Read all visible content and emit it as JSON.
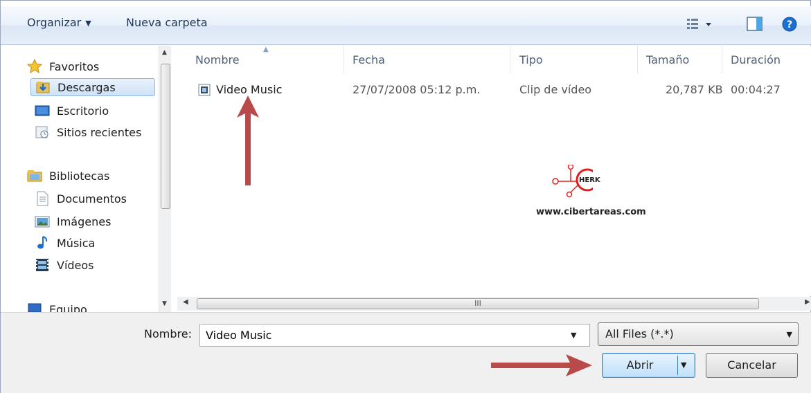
{
  "toolbar": {
    "organize_label": "Organizar",
    "new_folder_label": "Nueva carpeta",
    "views_icon": "views-icon",
    "preview_pane_icon": "preview-pane-icon",
    "help_icon": "help-icon"
  },
  "nav": {
    "favorites": "Favoritos",
    "items_favorites": [
      "Descargas",
      "Escritorio",
      "Sitios recientes"
    ],
    "libraries": "Bibliotecas",
    "items_libraries": [
      "Documentos",
      "Imágenes",
      "Música",
      "Vídeos"
    ],
    "computer": "Equipo"
  },
  "columns": [
    "Nombre",
    "Fecha",
    "Tipo",
    "Tamaño",
    "Duración"
  ],
  "files": [
    {
      "name": "Video Music",
      "date": "27/07/2008 05:12 p.m.",
      "type": "Clip de vídeo",
      "size": "20,787 KB",
      "duration": "00:04:27"
    }
  ],
  "watermark": {
    "logo_text": "HERK",
    "url": "www.cibertareas.com"
  },
  "scrollbar_grip": "III",
  "bottom": {
    "filename_label": "Nombre:",
    "filename_value": "Video Music",
    "filter_value": "All Files (*.*)",
    "open_label": "Abrir",
    "cancel_label": "Cancelar"
  },
  "colors": {
    "annotation_arrow": "#b84a4a",
    "toolbar_text": "#1e395b",
    "header_text": "#4c607a"
  }
}
